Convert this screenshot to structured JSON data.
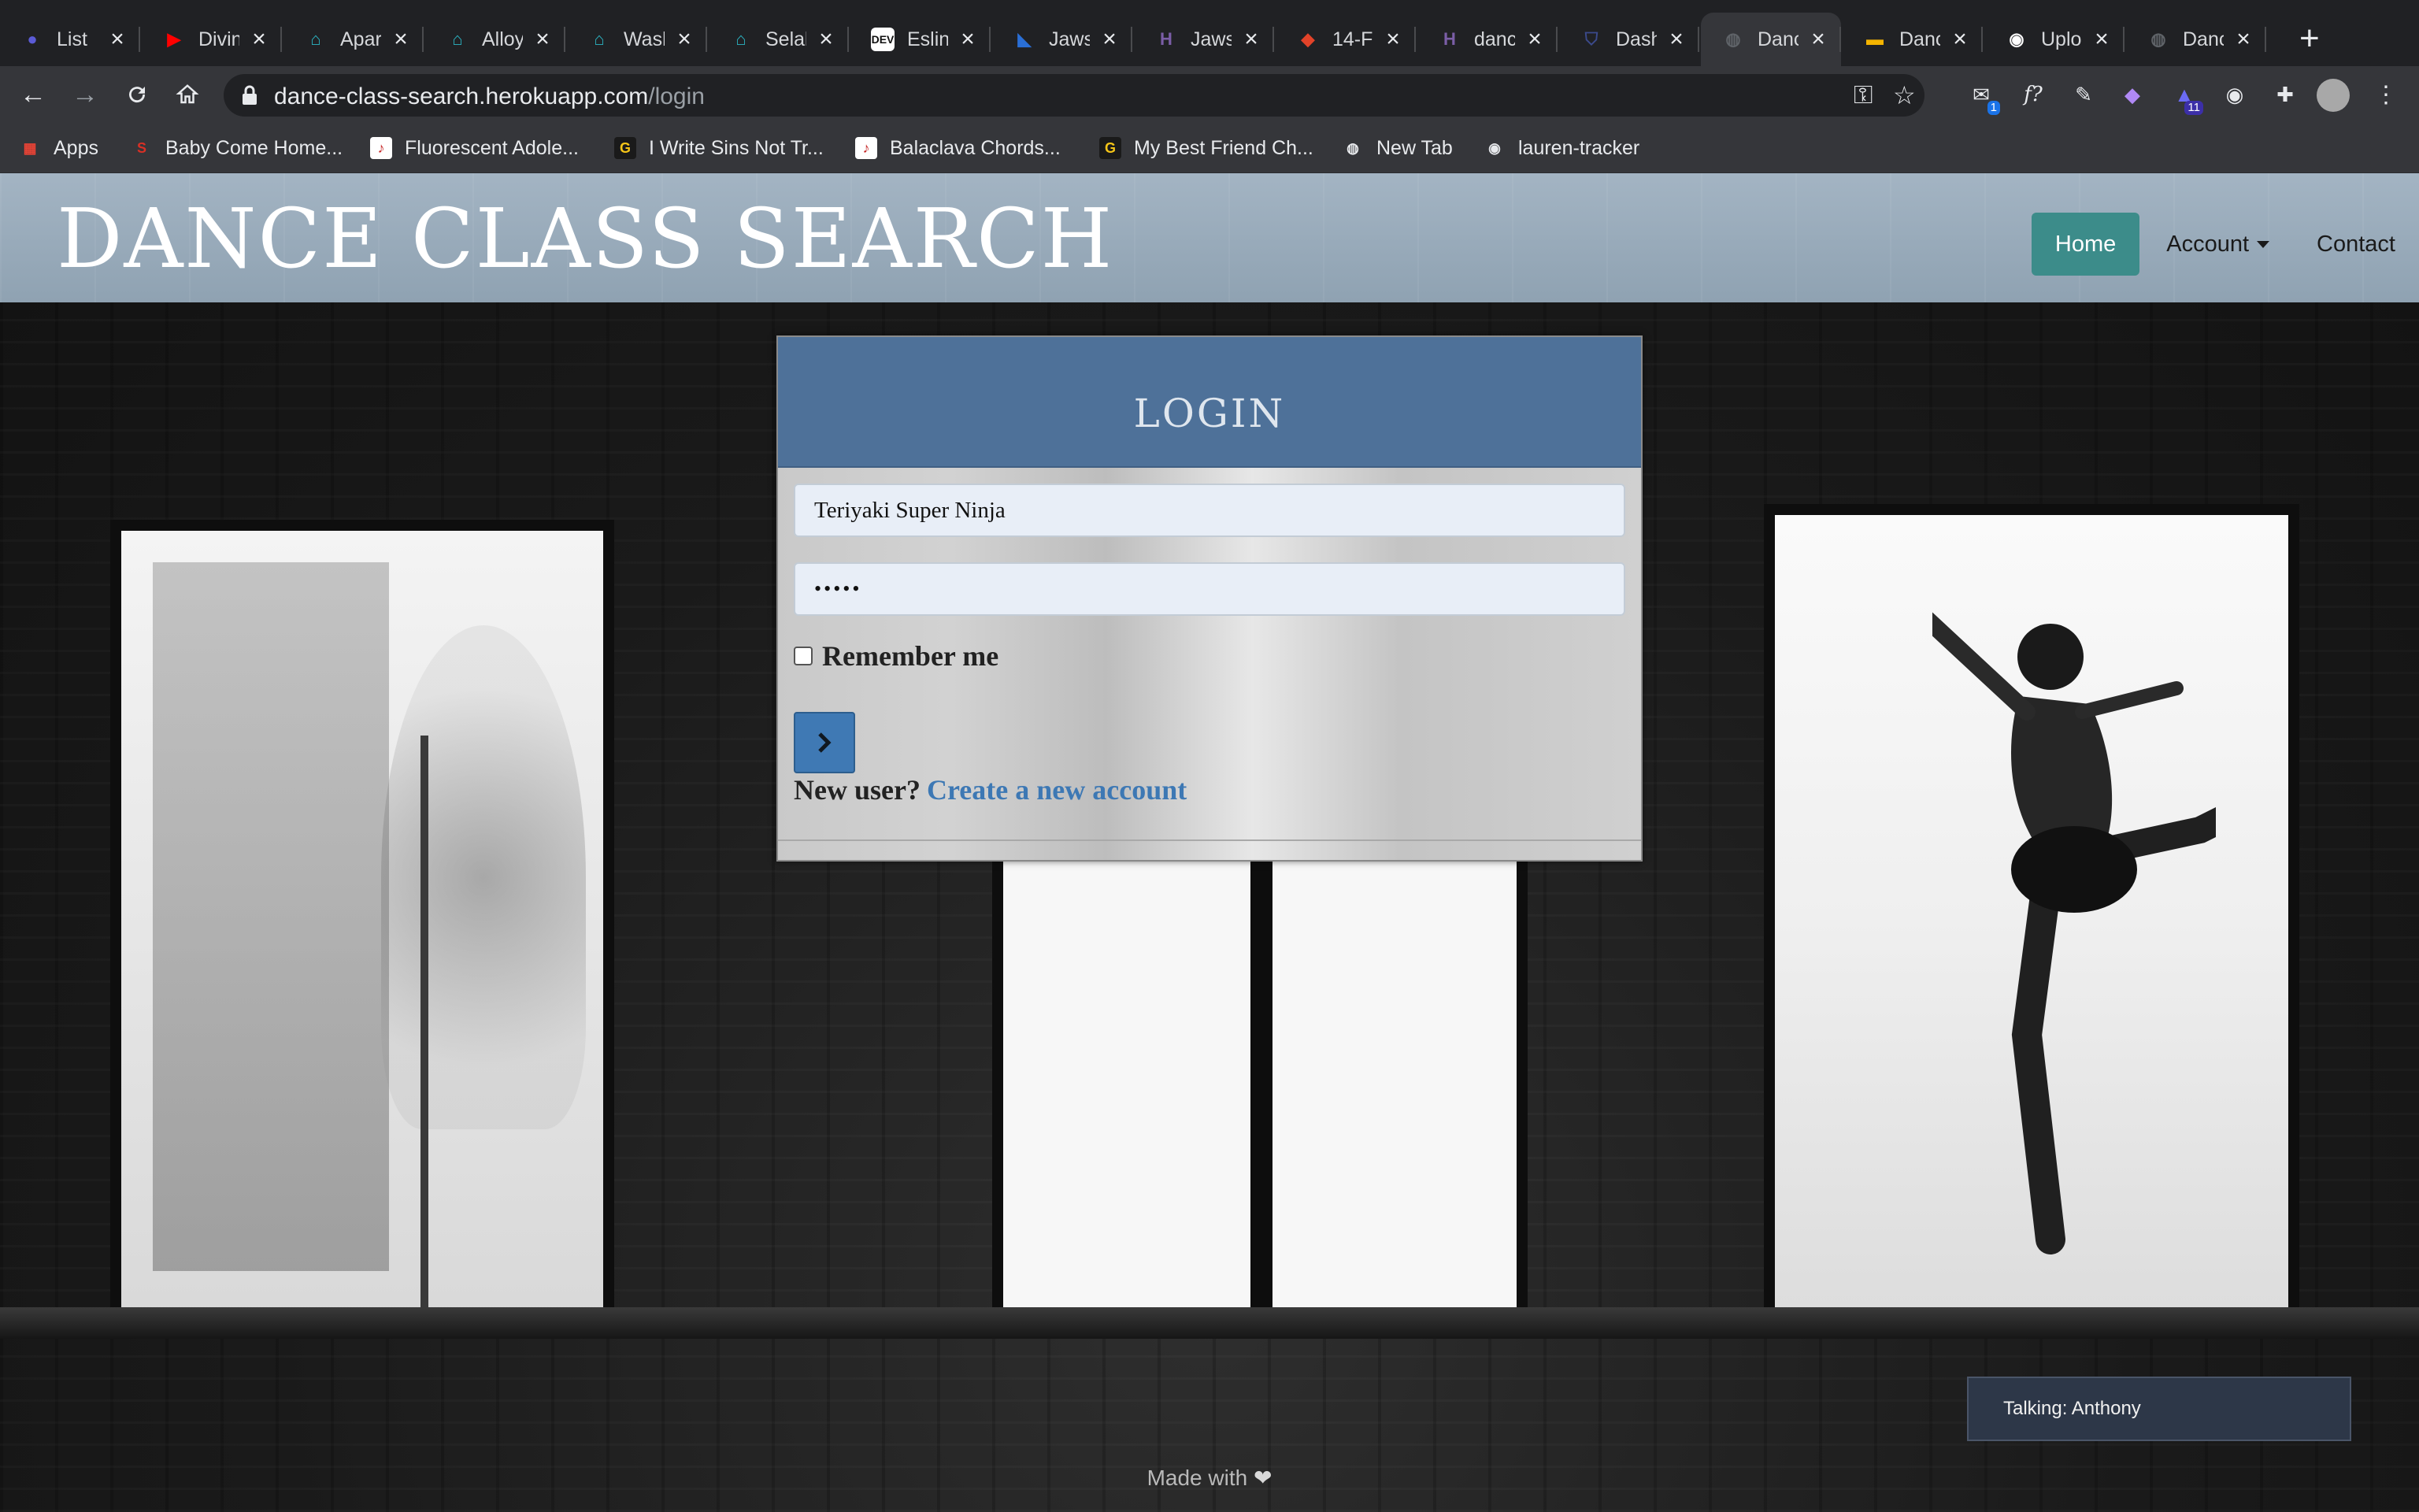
{
  "tabs": [
    {
      "label": "List",
      "icon": "circle-icon",
      "color": "#5b5bd6"
    },
    {
      "label": "Divin",
      "icon": "youtube-icon",
      "color": "#ff0000"
    },
    {
      "label": "Apar",
      "icon": "home-icon",
      "color": "#2bb5c4"
    },
    {
      "label": "Alloy",
      "icon": "home-icon",
      "color": "#2bb5c4"
    },
    {
      "label": "Wasl",
      "icon": "home-icon",
      "color": "#2bb5c4"
    },
    {
      "label": "Selal",
      "icon": "home-icon",
      "color": "#2bb5c4"
    },
    {
      "label": "Eslin",
      "icon": "dev-icon",
      "color": "#111111"
    },
    {
      "label": "Jaws",
      "icon": "jaws-icon",
      "color": "#2a6fd6"
    },
    {
      "label": "Jaws",
      "icon": "heroku-icon",
      "color": "#7b5ea7"
    },
    {
      "label": "14-F",
      "icon": "gitlab-icon",
      "color": "#e24329"
    },
    {
      "label": "danc",
      "icon": "heroku-icon",
      "color": "#7b5ea7"
    },
    {
      "label": "Dash",
      "icon": "shield-icon",
      "color": "#3b4a8c"
    },
    {
      "label": "Danc",
      "icon": "globe-icon",
      "color": "#5f6368"
    },
    {
      "label": "Danc",
      "icon": "slides-icon",
      "color": "#f4b400"
    },
    {
      "label": "Uplo",
      "icon": "github-icon",
      "color": "#ffffff"
    },
    {
      "label": "Danc",
      "icon": "globe-icon",
      "color": "#5f6368"
    }
  ],
  "address": {
    "domain": "dance-class-search.herokuapp.com",
    "path": "/login"
  },
  "bookmarks": [
    {
      "label": "Apps",
      "icon": "apps-grid-icon"
    },
    {
      "label": "Baby Come Home...",
      "icon": "s-icon"
    },
    {
      "label": "Fluorescent Adole...",
      "icon": "guitar-icon"
    },
    {
      "label": "I Write Sins Not Tr...",
      "icon": "g-icon"
    },
    {
      "label": "Balaclava Chords...",
      "icon": "guitar-icon"
    },
    {
      "label": "My Best Friend Ch...",
      "icon": "g-icon"
    },
    {
      "label": "New Tab",
      "icon": "globe-icon"
    },
    {
      "label": "lauren-tracker",
      "icon": "github-icon"
    }
  ],
  "extensions": {
    "badge_1": "1",
    "badge_2": "11",
    "fx_label": "f?"
  },
  "site": {
    "brand": "DANCE CLASS SEARCH",
    "nav": {
      "home": "Home",
      "account": "Account",
      "contact": "Contact"
    }
  },
  "login": {
    "title": "LOGIN",
    "username_value": "Teriyaki Super Ninja",
    "password_value": "•••••",
    "remember_label": "Remember me",
    "new_user_text": "New user?",
    "create_account_link": "Create a new account"
  },
  "footer": {
    "text": "Made with",
    "icon": "heart-icon"
  },
  "toast": {
    "text": "Talking: Anthony"
  },
  "colors": {
    "nav_active": "#3c8c8a",
    "card_header": "#4e7199",
    "link": "#3d78b4",
    "submit": "#3f79b4"
  }
}
